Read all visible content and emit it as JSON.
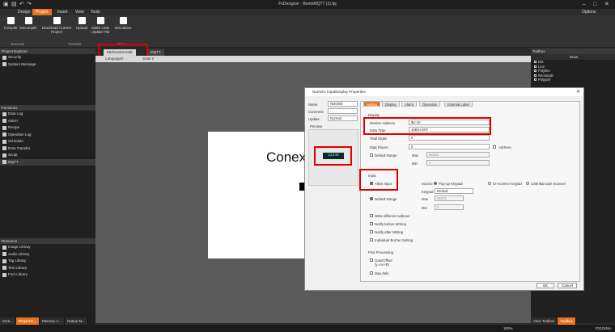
{
  "window": {
    "title": "FvDesigner - BeeteMQTT (1).fpj"
  },
  "menu": {
    "tabs": [
      "Design",
      "Project",
      "Insert",
      "View",
      "Tools"
    ],
    "active": "Project",
    "options": "Options"
  },
  "ribbon": {
    "buttons": [
      "Compile",
      "Decompile",
      "Download Current Project",
      "Upload",
      "Make USB Update File",
      "Simulation"
    ],
    "groups": {
      "execute": "Execute",
      "transfer": "Transfer",
      "run": "Run"
    }
  },
  "left_panel": {
    "project_header": "Project Explorer",
    "project_items": [
      "Security",
      "System Message"
    ],
    "functions_header": "Functions",
    "functions_items": [
      "Data Log",
      "Alarm",
      "Recipe",
      "Operation Log",
      "Schedule",
      "Data Transfer",
      "Script",
      "MQTT"
    ],
    "resource_header": "Resource",
    "resource_items": [
      "Image Library",
      "Audio Library",
      "Tag Library",
      "Text Library",
      "Font Library"
    ]
  },
  "bottom_tabs": [
    "Scre...",
    "Project E...",
    "Memory A...",
    "Output M..."
  ],
  "doc_tabs": {
    "screen": "8S/ScreenAnd0",
    "mqtt": "MQTT"
  },
  "doc_toolbar": {
    "language": "Language0",
    "state": "State 0"
  },
  "canvas": {
    "text": "Conexã"
  },
  "toolbox": {
    "header": "Toolbox",
    "draw": "Draw",
    "items": [
      "Dot",
      "Line",
      "Polyline",
      "Rectangle",
      "Polygon"
    ],
    "tabs": [
      "View Toolbox",
      "Toolbox"
    ]
  },
  "dialog": {
    "title": "Numeric Input/Display Properties",
    "left": {
      "name_label": "Name",
      "name_value": "ND0000",
      "comment_label": "Comment",
      "update_label": "Update",
      "update_value": "Normal",
      "preview_label": "Preview",
      "preview_value": "12345"
    },
    "tabs": [
      "Setting",
      "Display",
      "Alarm",
      "Operation",
      "External Label"
    ],
    "display_section": "Display",
    "monitor_address_label": "Monitor Address",
    "monitor_address_value": "$U 40",
    "data_type_label": "Data Type",
    "data_type_value": "16Bit-UINT",
    "total_digits_label": "Total Digits",
    "total_digits_value": "5",
    "digit_places_label": "Digit Places",
    "digit_places_value": "0",
    "address_label": "Address",
    "default_range_label": "Default Range",
    "max_label": "Max",
    "max_value": "65535",
    "min_label": "Min",
    "min_value": "0",
    "input_section": "Input",
    "allow_input_label": "Allow Input",
    "source_label": "Source",
    "popup_keypad": "Pop-up Keypad",
    "onscreen_keypad": "On-screen Keypad",
    "usb_scanner": "USB Barcode Scanner",
    "keypad_label": "Keypad",
    "keypad_value": "Default",
    "input_default_range": "Default Range",
    "input_max_value": "65535",
    "input_min_value": "0",
    "write_diff": "Write different Address",
    "notify_before": "Notify before Writing",
    "notify_after": "Notify after Writing",
    "buzzer": "Individual Buzzer Setting",
    "post_section": "Post Processing",
    "gain_offset": "Gain/Offset (y=Ax+B)",
    "maxmin": "Max./Min.",
    "ok": "OK",
    "cancel": "Cancel"
  },
  "status": {
    "zoom": "100%",
    "right_text": "P3101NA"
  }
}
